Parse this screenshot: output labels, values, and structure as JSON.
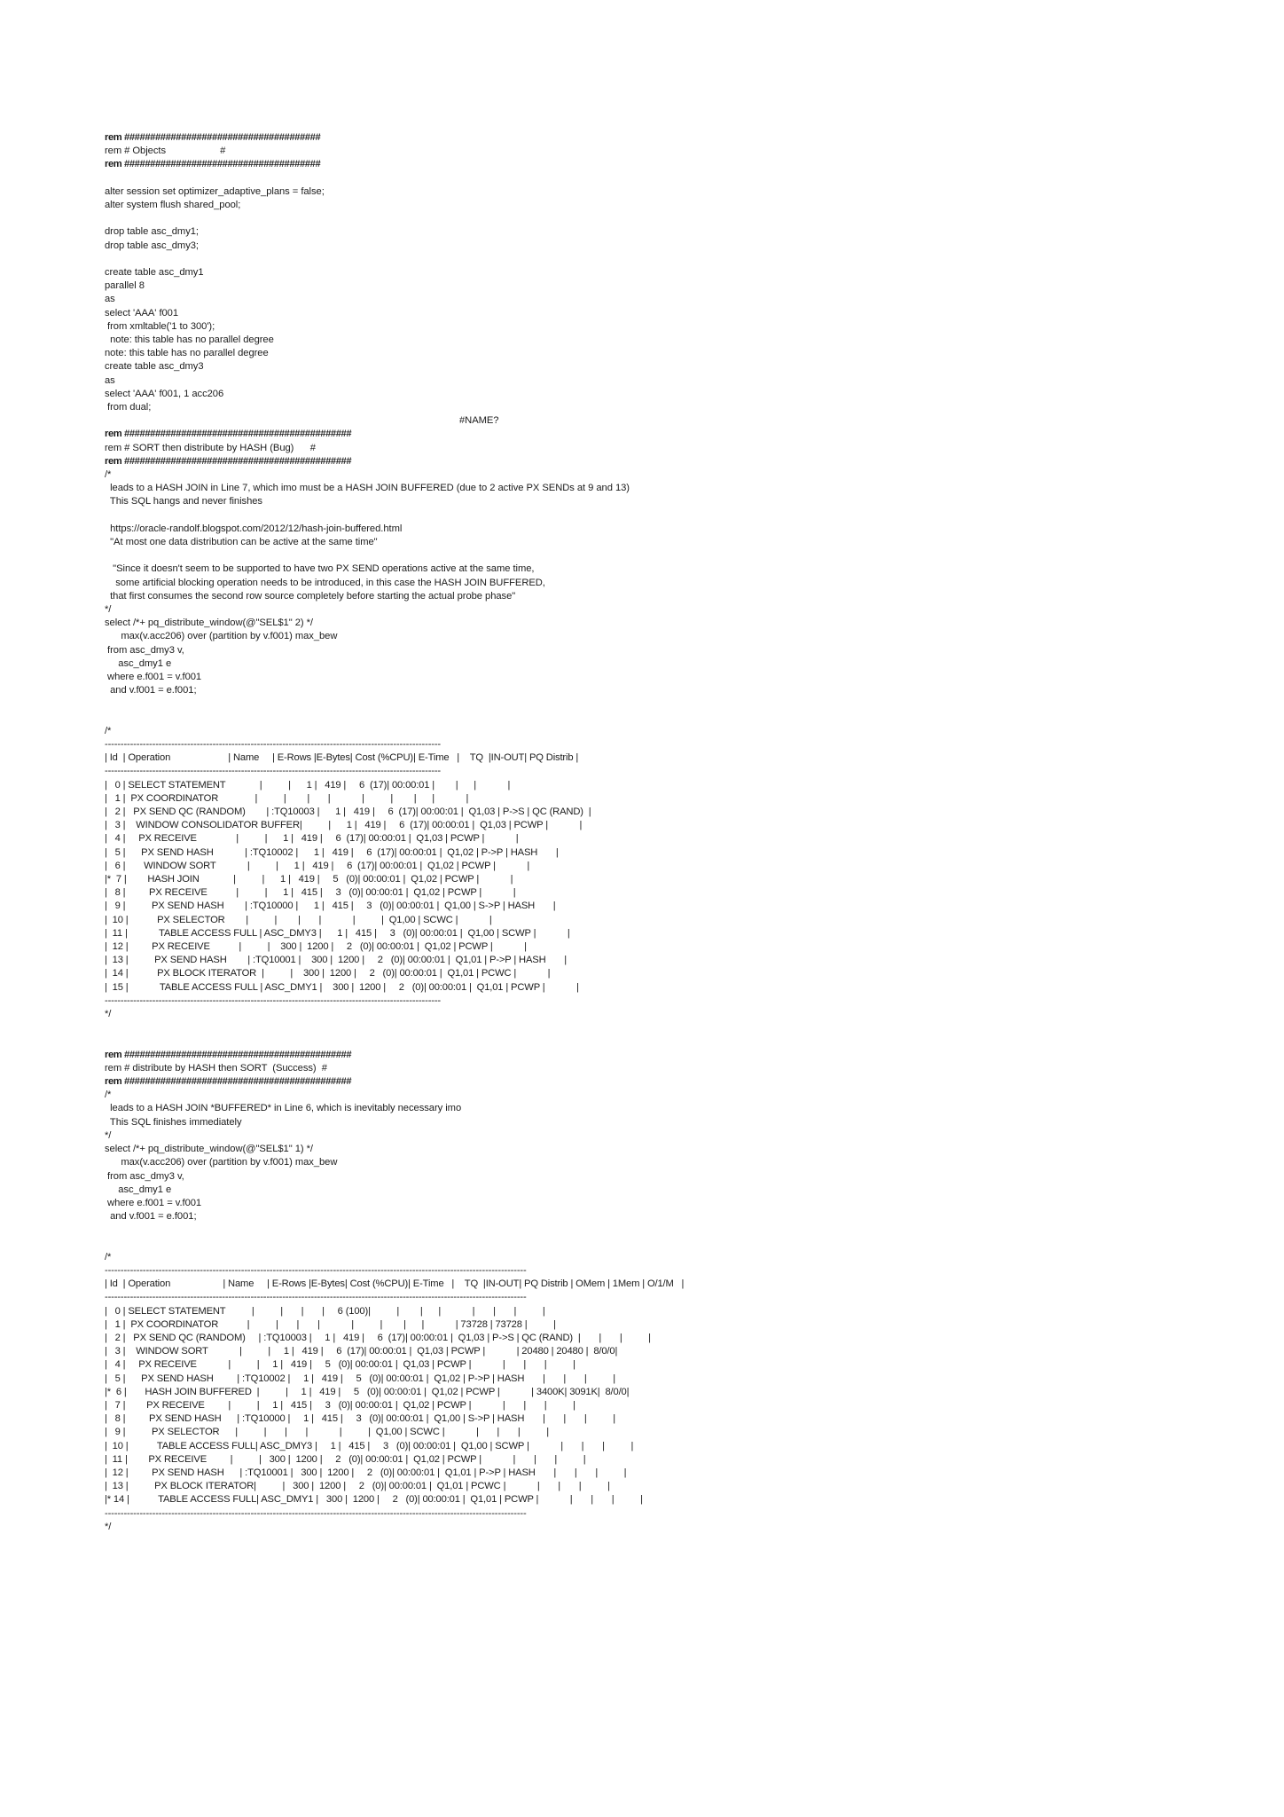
{
  "document": {
    "kind": "sql-script-printout",
    "page_background": "#ffffff",
    "text_color": "#1c1c1c"
  },
  "content": {
    "blocks": [
      {
        "id": "objects-banner-top",
        "text": "rem ######################################"
      },
      {
        "id": "objects-banner-title",
        "text": "rem # Objects                    #"
      },
      {
        "id": "objects-banner-bottom",
        "text": "rem ######################################"
      },
      {
        "id": "blank-1",
        "text": ""
      },
      {
        "id": "alter-session",
        "text": "alter session set optimizer_adaptive_plans = false;"
      },
      {
        "id": "alter-system",
        "text": "alter system flush shared_pool;"
      },
      {
        "id": "blank-2",
        "text": ""
      },
      {
        "id": "drop-dmy1",
        "text": "drop table asc_dmy1;"
      },
      {
        "id": "drop-dmy3",
        "text": "drop table asc_dmy3;"
      },
      {
        "id": "blank-3",
        "text": ""
      },
      {
        "id": "create-dmy1",
        "text": "create table asc_dmy1"
      },
      {
        "id": "create-dmy1-parallel",
        "text": "parallel 8"
      },
      {
        "id": "create-dmy1-as",
        "text": "as"
      },
      {
        "id": "create-dmy1-select",
        "text": "select 'AAA' f001"
      },
      {
        "id": "create-dmy1-from",
        "text": " from xmltable('1 to 300');"
      },
      {
        "id": "note-1",
        "text": "  note: this table has no parallel degree"
      },
      {
        "id": "note-2",
        "text": "note: this table has no parallel degree"
      },
      {
        "id": "create-dmy3",
        "text": "create table asc_dmy3"
      },
      {
        "id": "create-dmy3-as",
        "text": "as"
      },
      {
        "id": "create-dmy3-select",
        "text": "select 'AAA' f001, 1 acc206"
      },
      {
        "id": "create-dmy3-from",
        "text": " from dual;"
      },
      {
        "id": "name-error",
        "text": "#NAME?"
      },
      {
        "id": "sort-banner-top",
        "text": "rem ############################################"
      },
      {
        "id": "sort-banner-title",
        "text": "rem # SORT then distribute by HASH (Bug)      #"
      },
      {
        "id": "sort-banner-bottom",
        "text": "rem ############################################"
      },
      {
        "id": "comment-open-1",
        "text": "/*"
      },
      {
        "id": "bug-desc-1",
        "text": "  leads to a HASH JOIN in Line 7, which imo must be a HASH JOIN BUFFERED (due to 2 active PX SENDs at 9 and 13)"
      },
      {
        "id": "bug-desc-2",
        "text": "  This SQL hangs and never finishes"
      },
      {
        "id": "blank-4",
        "text": ""
      },
      {
        "id": "blog-url",
        "text": "  https://oracle-randolf.blogspot.com/2012/12/hash-join-buffered.html"
      },
      {
        "id": "blog-quote",
        "text": "  \"At most one data distribution can be active at the same time\""
      },
      {
        "id": "blank-5",
        "text": ""
      },
      {
        "id": "quote-line-1",
        "text": "   \"Since it doesn't seem to be supported to have two PX SEND operations active at the same time,"
      },
      {
        "id": "quote-line-2",
        "text": "    some artificial blocking operation needs to be introduced, in this case the HASH JOIN BUFFERED,"
      },
      {
        "id": "quote-line-3",
        "text": "  that first consumes the second row source completely before starting the actual probe phase\""
      },
      {
        "id": "comment-close-1",
        "text": "*/"
      },
      {
        "id": "sql1-select",
        "text": "select /*+ pq_distribute_window(@\"SEL$1\" 2) */"
      },
      {
        "id": "sql1-max",
        "text": "      max(v.acc206) over (partition by v.f001) max_bew"
      },
      {
        "id": "sql1-from",
        "text": " from asc_dmy3 v,"
      },
      {
        "id": "sql1-join",
        "text": "     asc_dmy1 e"
      },
      {
        "id": "sql1-where",
        "text": " where e.f001 = v.f001"
      },
      {
        "id": "sql1-and",
        "text": "  and v.f001 = e.f001;"
      },
      {
        "id": "blank-6",
        "text": ""
      },
      {
        "id": "blank-7",
        "text": ""
      },
      {
        "id": "comment-open-2",
        "text": "/*"
      }
    ],
    "blocks_after_plan1": [
      {
        "id": "comment-close-2",
        "text": "*/"
      },
      {
        "id": "blank-8",
        "text": ""
      },
      {
        "id": "blank-9",
        "text": ""
      },
      {
        "id": "succ-banner-top",
        "text": "rem ############################################"
      },
      {
        "id": "succ-banner-title",
        "text": "rem # distribute by HASH then SORT  (Success)  #"
      },
      {
        "id": "succ-banner-bottom",
        "text": "rem ############################################"
      },
      {
        "id": "comment-open-3",
        "text": "/*"
      },
      {
        "id": "succ-desc-1",
        "text": "  leads to a HASH JOIN *BUFFERED* in Line 6, which is inevitably necessary imo"
      },
      {
        "id": "succ-desc-2",
        "text": "  This SQL finishes immediately"
      },
      {
        "id": "comment-close-3",
        "text": "*/"
      },
      {
        "id": "sql2-select",
        "text": "select /*+ pq_distribute_window(@\"SEL$1\" 1) */"
      },
      {
        "id": "sql2-max",
        "text": "      max(v.acc206) over (partition by v.f001) max_bew"
      },
      {
        "id": "sql2-from",
        "text": " from asc_dmy3 v,"
      },
      {
        "id": "sql2-join",
        "text": "     asc_dmy1 e"
      },
      {
        "id": "sql2-where",
        "text": " where e.f001 = v.f001"
      },
      {
        "id": "sql2-and",
        "text": "  and v.f001 = e.f001;"
      },
      {
        "id": "blank-10",
        "text": ""
      },
      {
        "id": "blank-11",
        "text": ""
      },
      {
        "id": "comment-open-4",
        "text": "/*"
      }
    ],
    "blocks_after_plan2": [
      {
        "id": "comment-close-4",
        "text": "*/"
      }
    ]
  },
  "plan1": {
    "title": "execution-plan-bug",
    "separator_top": "----------------------------------------------------------------------------------------------------------",
    "header": "| Id  | Operation                      | Name     | E-Rows |E-Bytes| Cost (%CPU)| E-Time   |    TQ  |IN-OUT| PQ Distrib |",
    "separator_mid": "----------------------------------------------------------------------------------------------------------",
    "rows": [
      "|   0 | SELECT STATEMENT             |          |      1 |   419 |     6  (17)| 00:00:01 |        |      |            |",
      "|   1 |  PX COORDINATOR              |          |        |       |            |          |        |      |            |",
      "|   2 |   PX SEND QC (RANDOM)        | :TQ10003 |      1 |   419 |     6  (17)| 00:00:01 |  Q1,03 | P->S | QC (RAND)  |",
      "|   3 |    WINDOW CONSOLIDATOR BUFFER|          |      1 |   419 |     6  (17)| 00:00:01 |  Q1,03 | PCWP |            |",
      "|   4 |     PX RECEIVE               |          |      1 |   419 |     6  (17)| 00:00:01 |  Q1,03 | PCWP |            |",
      "|   5 |      PX SEND HASH            | :TQ10002 |      1 |   419 |     6  (17)| 00:00:01 |  Q1,02 | P->P | HASH       |",
      "|   6 |       WINDOW SORT            |          |      1 |   419 |     6  (17)| 00:00:01 |  Q1,02 | PCWP |            |",
      "|*  7 |        HASH JOIN             |          |      1 |   419 |     5   (0)| 00:00:01 |  Q1,02 | PCWP |            |",
      "|   8 |         PX RECEIVE           |          |      1 |   415 |     3   (0)| 00:00:01 |  Q1,02 | PCWP |            |",
      "|   9 |          PX SEND HASH        | :TQ10000 |      1 |   415 |     3   (0)| 00:00:01 |  Q1,00 | S->P | HASH       |",
      "|  10 |           PX SELECTOR        |          |        |       |            |          |  Q1,00 | SCWC |            |",
      "|  11 |            TABLE ACCESS FULL | ASC_DMY3 |      1 |   415 |     3   (0)| 00:00:01 |  Q1,00 | SCWP |            |",
      "|  12 |         PX RECEIVE           |          |    300 |  1200 |     2   (0)| 00:00:01 |  Q1,02 | PCWP |            |",
      "|  13 |          PX SEND HASH        | :TQ10001 |    300 |  1200 |     2   (0)| 00:00:01 |  Q1,01 | P->P | HASH       |",
      "|  14 |           PX BLOCK ITERATOR  |          |    300 |  1200 |     2   (0)| 00:00:01 |  Q1,01 | PCWC |            |",
      "|  15 |            TABLE ACCESS FULL | ASC_DMY1 |    300 |  1200 |     2   (0)| 00:00:01 |  Q1,01 | PCWP |            |"
    ],
    "separator_bottom": "----------------------------------------------------------------------------------------------------------"
  },
  "plan2": {
    "title": "execution-plan-success",
    "separator_top": "-------------------------------------------------------------------------------------------------------------------------------------",
    "header": "| Id  | Operation                    | Name     | E-Rows |E-Bytes| Cost (%CPU)| E-Time   |    TQ  |IN-OUT| PQ Distrib | OMem | 1Mem | O/1/M   |",
    "separator_mid": "-------------------------------------------------------------------------------------------------------------------------------------",
    "rows": [
      "|   0 | SELECT STATEMENT          |          |       |       |     6 (100)|          |        |      |            |       |       |          |",
      "|   1 |  PX COORDINATOR           |          |       |       |            |          |        |      |            | 73728 | 73728 |          |",
      "|   2 |   PX SEND QC (RANDOM)     | :TQ10003 |     1 |   419 |     6  (17)| 00:00:01 |  Q1,03 | P->S | QC (RAND)  |       |       |          |",
      "|   3 |    WINDOW SORT            |          |     1 |   419 |     6  (17)| 00:00:01 |  Q1,03 | PCWP |            | 20480 | 20480 |  8/0/0|",
      "|   4 |     PX RECEIVE            |          |     1 |   419 |     5   (0)| 00:00:01 |  Q1,03 | PCWP |            |       |       |          |",
      "|   5 |      PX SEND HASH         | :TQ10002 |     1 |   419 |     5   (0)| 00:00:01 |  Q1,02 | P->P | HASH       |       |       |          |",
      "|*  6 |       HASH JOIN BUFFERED  |          |     1 |   419 |     5   (0)| 00:00:01 |  Q1,02 | PCWP |            | 3400K| 3091K|  8/0/0|",
      "|   7 |        PX RECEIVE         |          |     1 |   415 |     3   (0)| 00:00:01 |  Q1,02 | PCWP |            |       |       |          |",
      "|   8 |         PX SEND HASH      | :TQ10000 |     1 |   415 |     3   (0)| 00:00:01 |  Q1,00 | S->P | HASH       |       |       |          |",
      "|   9 |          PX SELECTOR      |          |       |       |            |          |  Q1,00 | SCWC |            |       |       |          |",
      "|  10 |           TABLE ACCESS FULL| ASC_DMY3 |     1 |   415 |     3   (0)| 00:00:01 |  Q1,00 | SCWP |            |       |       |          |",
      "|  11 |        PX RECEIVE         |          |   300 |  1200 |     2   (0)| 00:00:01 |  Q1,02 | PCWP |            |       |       |          |",
      "|  12 |         PX SEND HASH      | :TQ10001 |   300 |  1200 |     2   (0)| 00:00:01 |  Q1,01 | P->P | HASH       |       |       |          |",
      "|  13 |          PX BLOCK ITERATOR|          |   300 |  1200 |     2   (0)| 00:00:01 |  Q1,01 | PCWC |            |       |       |          |",
      "|* 14 |           TABLE ACCESS FULL| ASC_DMY1 |   300 |  1200 |     2   (0)| 00:00:01 |  Q1,01 | PCWP |            |       |       |          |"
    ],
    "separator_bottom": "-------------------------------------------------------------------------------------------------------------------------------------"
  }
}
